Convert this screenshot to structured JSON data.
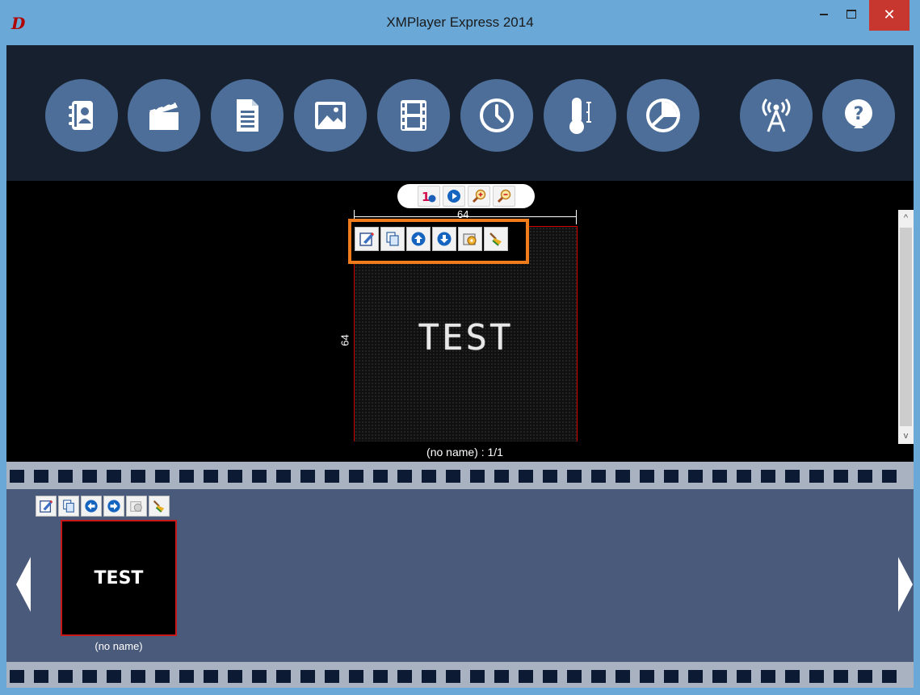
{
  "window": {
    "title": "XMPlayer Express 2014",
    "app_icon": "D",
    "close_glyph": "✕"
  },
  "toolbar": {
    "buttons": [
      {
        "name": "contacts-icon"
      },
      {
        "name": "clapperboard-icon"
      },
      {
        "name": "document-icon"
      },
      {
        "name": "image-icon"
      },
      {
        "name": "film-icon"
      },
      {
        "name": "clock-icon"
      },
      {
        "name": "thermometer-icon"
      },
      {
        "name": "pie-chart-icon"
      },
      {
        "name": "broadcast-antenna-icon"
      },
      {
        "name": "help-icon"
      }
    ],
    "accent": "#4c6e99",
    "background": "#17202f"
  },
  "editor": {
    "width_label": "64",
    "height_label": "64",
    "canvas_text": "TEST",
    "page_label": "(no name) : 1/1",
    "highlight_color": "#f07c1c",
    "frame_border_color": "#d40000"
  },
  "filmstrip": {
    "thumbnail_text": "TEST",
    "thumbnail_label": "(no name)"
  }
}
